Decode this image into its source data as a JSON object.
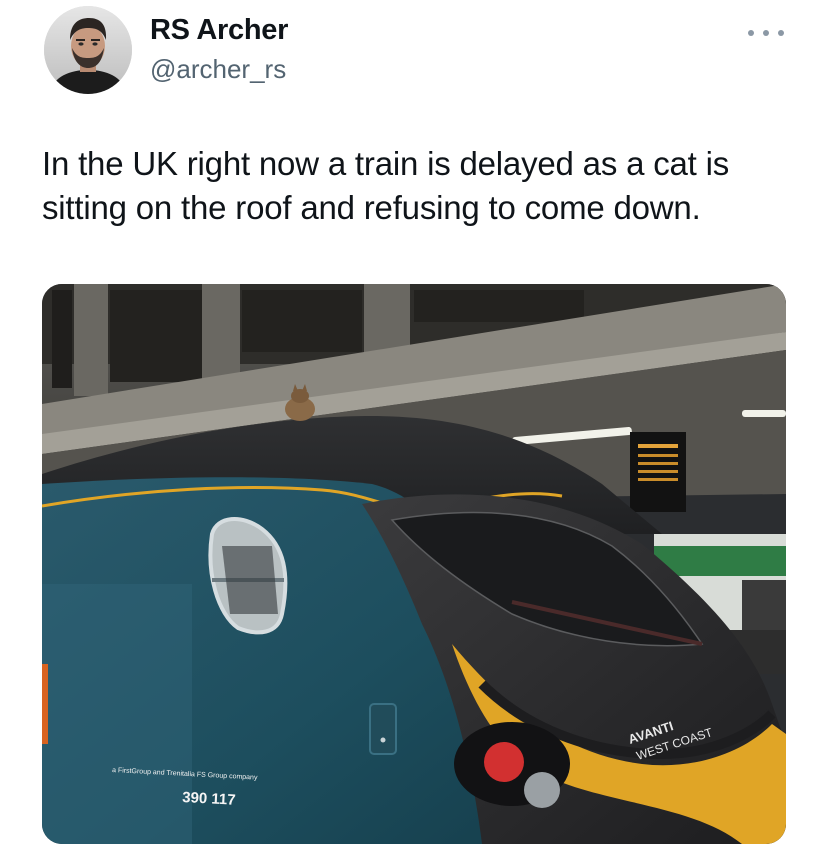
{
  "author": {
    "display_name": "RS Archer",
    "handle": "@archer_rs"
  },
  "tweet": {
    "text_line_1": "In the UK right now a train is delayed as a cat is",
    "text_line_2": "sitting on the roof and refusing to come down."
  },
  "photo": {
    "livery_logo_line_1": "AVANTI",
    "livery_logo_line_2": "WEST COAST",
    "small_print": "a FirstGroup and Trenitalia FS Group company",
    "unit_number": "390 117"
  },
  "icons": {
    "more": "more-horizontal-icon",
    "avatar": "profile-photo"
  },
  "colors": {
    "text_primary": "#0f1419",
    "text_secondary": "#536471",
    "train_teal": "#1d4e5e",
    "train_gold": "#e0a526"
  }
}
